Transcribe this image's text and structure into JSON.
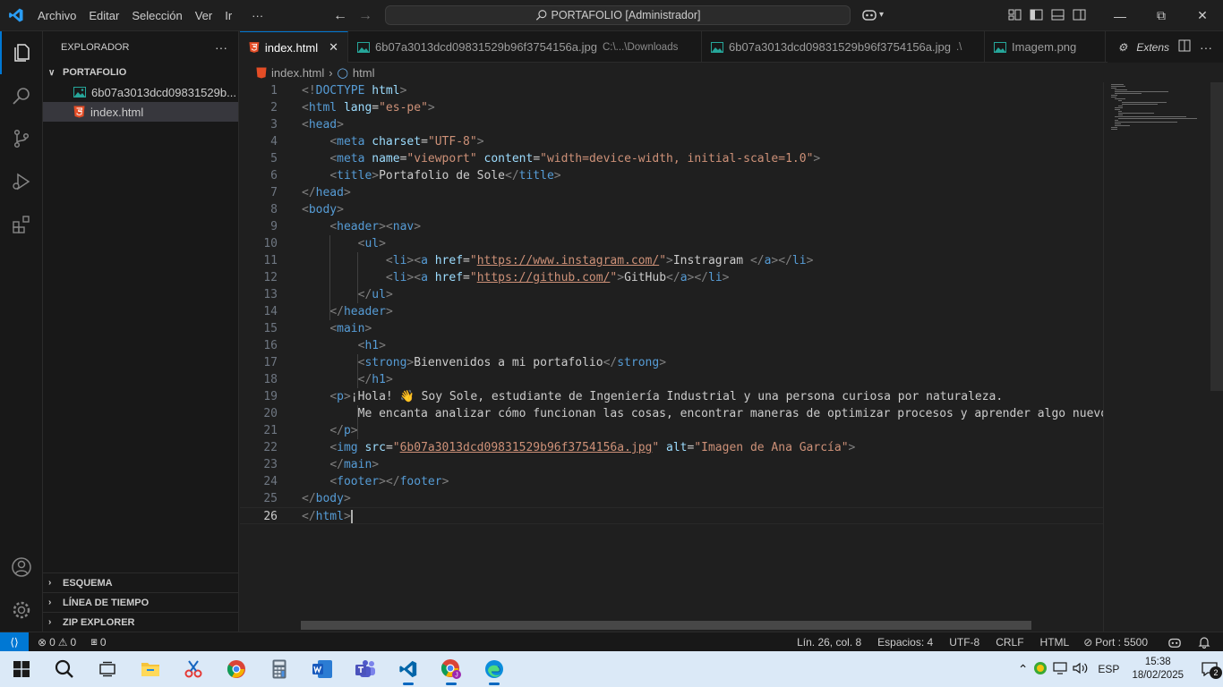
{
  "titlebar": {
    "menu": [
      "Archivo",
      "Editar",
      "Selección",
      "Ver",
      "Ir"
    ],
    "more": "···",
    "command_center": "PORTAFOLIO [Administrador]"
  },
  "sidebar": {
    "title": "EXPLORADOR",
    "more": "···",
    "folder": "PORTAFOLIO",
    "files": [
      {
        "name": "6b07a3013dcd09831529b...",
        "icon": "image-file-icon"
      },
      {
        "name": "index.html",
        "icon": "html-file-icon"
      }
    ],
    "sections": [
      "ESQUEMA",
      "LÍNEA DE TIEMPO",
      "ZIP EXPLORER"
    ]
  },
  "tabs": [
    {
      "label": "index.html",
      "desc": "",
      "active": true
    },
    {
      "label": "6b07a3013dcd09831529b96f3754156a.jpg",
      "desc": "C:\\...\\Downloads",
      "active": false
    },
    {
      "label": "6b07a3013dcd09831529b96f3754156a.jpg",
      "desc": ".\\",
      "active": false
    },
    {
      "label": "Imagem.png",
      "desc": "",
      "active": false
    }
  ],
  "tab_actions": {
    "extens": "Extens"
  },
  "breadcrumb": {
    "file": "index.html",
    "symbol": "html"
  },
  "editor": {
    "current_line": 26,
    "lines": [
      [
        [
          "t",
          "<!"
        ],
        [
          "tag",
          "DOCTYPE"
        ],
        [
          "txt",
          " "
        ],
        [
          "attr",
          "html"
        ],
        [
          "t",
          ">"
        ]
      ],
      [
        [
          "t",
          "<"
        ],
        [
          "tag",
          "html"
        ],
        [
          "txt",
          " "
        ],
        [
          "attr",
          "lang"
        ],
        [
          "txt",
          "="
        ],
        [
          "str",
          "\"es-pe\""
        ],
        [
          "t",
          ">"
        ]
      ],
      [
        [
          "t",
          "<"
        ],
        [
          "tag",
          "head"
        ],
        [
          "t",
          ">"
        ]
      ],
      [
        [
          "txt",
          "    "
        ],
        [
          "t",
          "<"
        ],
        [
          "tag",
          "meta"
        ],
        [
          "txt",
          " "
        ],
        [
          "attr",
          "charset"
        ],
        [
          "txt",
          "="
        ],
        [
          "str",
          "\"UTF-8\""
        ],
        [
          "t",
          ">"
        ]
      ],
      [
        [
          "txt",
          "    "
        ],
        [
          "t",
          "<"
        ],
        [
          "tag",
          "meta"
        ],
        [
          "txt",
          " "
        ],
        [
          "attr",
          "name"
        ],
        [
          "txt",
          "="
        ],
        [
          "str",
          "\"viewport\""
        ],
        [
          "txt",
          " "
        ],
        [
          "attr",
          "content"
        ],
        [
          "txt",
          "="
        ],
        [
          "str",
          "\"width=device-width, initial-scale=1.0\""
        ],
        [
          "t",
          ">"
        ]
      ],
      [
        [
          "txt",
          "    "
        ],
        [
          "t",
          "<"
        ],
        [
          "tag",
          "title"
        ],
        [
          "t",
          ">"
        ],
        [
          "txt",
          "Portafolio de Sole"
        ],
        [
          "t",
          "</"
        ],
        [
          "tag",
          "title"
        ],
        [
          "t",
          ">"
        ]
      ],
      [
        [
          "t",
          "</"
        ],
        [
          "tag",
          "head"
        ],
        [
          "t",
          ">"
        ]
      ],
      [
        [
          "t",
          "<"
        ],
        [
          "tag",
          "body"
        ],
        [
          "t",
          ">"
        ]
      ],
      [
        [
          "txt",
          "    "
        ],
        [
          "t",
          "<"
        ],
        [
          "tag",
          "header"
        ],
        [
          "t",
          "><"
        ],
        [
          "tag",
          "nav"
        ],
        [
          "t",
          ">"
        ]
      ],
      [
        [
          "txt",
          "        "
        ],
        [
          "t",
          "<"
        ],
        [
          "tag",
          "ul"
        ],
        [
          "t",
          ">"
        ]
      ],
      [
        [
          "txt",
          "            "
        ],
        [
          "t",
          "<"
        ],
        [
          "tag",
          "li"
        ],
        [
          "t",
          "><"
        ],
        [
          "tag",
          "a"
        ],
        [
          "txt",
          " "
        ],
        [
          "attr",
          "href"
        ],
        [
          "txt",
          "="
        ],
        [
          "str",
          "\""
        ],
        [
          "link",
          "https://www.instagram.com/"
        ],
        [
          "str",
          "\""
        ],
        [
          "t",
          ">"
        ],
        [
          "txt",
          "Instragram "
        ],
        [
          "t",
          "</"
        ],
        [
          "tag",
          "a"
        ],
        [
          "t",
          "></"
        ],
        [
          "tag",
          "li"
        ],
        [
          "t",
          ">"
        ]
      ],
      [
        [
          "txt",
          "            "
        ],
        [
          "t",
          "<"
        ],
        [
          "tag",
          "li"
        ],
        [
          "t",
          "><"
        ],
        [
          "tag",
          "a"
        ],
        [
          "txt",
          " "
        ],
        [
          "attr",
          "href"
        ],
        [
          "txt",
          "="
        ],
        [
          "str",
          "\""
        ],
        [
          "link",
          "https://github.com/"
        ],
        [
          "str",
          "\""
        ],
        [
          "t",
          ">"
        ],
        [
          "txt",
          "GitHub"
        ],
        [
          "t",
          "</"
        ],
        [
          "tag",
          "a"
        ],
        [
          "t",
          "></"
        ],
        [
          "tag",
          "li"
        ],
        [
          "t",
          ">"
        ]
      ],
      [
        [
          "txt",
          "        "
        ],
        [
          "t",
          "</"
        ],
        [
          "tag",
          "ul"
        ],
        [
          "t",
          ">"
        ]
      ],
      [
        [
          "txt",
          "    "
        ],
        [
          "t",
          "</"
        ],
        [
          "tag",
          "header"
        ],
        [
          "t",
          ">"
        ]
      ],
      [
        [
          "txt",
          "    "
        ],
        [
          "t",
          "<"
        ],
        [
          "tag",
          "main"
        ],
        [
          "t",
          ">"
        ]
      ],
      [
        [
          "txt",
          "        "
        ],
        [
          "t",
          "<"
        ],
        [
          "tag",
          "h1"
        ],
        [
          "t",
          ">"
        ]
      ],
      [
        [
          "txt",
          "        "
        ],
        [
          "t",
          "<"
        ],
        [
          "tag",
          "strong"
        ],
        [
          "t",
          ">"
        ],
        [
          "txt",
          "Bienvenidos a mi portafolio"
        ],
        [
          "t",
          "</"
        ],
        [
          "tag",
          "strong"
        ],
        [
          "t",
          ">"
        ]
      ],
      [
        [
          "txt",
          "        "
        ],
        [
          "t",
          "</"
        ],
        [
          "tag",
          "h1"
        ],
        [
          "t",
          ">"
        ]
      ],
      [
        [
          "txt",
          "    "
        ],
        [
          "t",
          "<"
        ],
        [
          "tag",
          "p"
        ],
        [
          "t",
          ">"
        ],
        [
          "txt",
          "¡Hola! 👋 Soy Sole, estudiante de Ingeniería Industrial y una persona curiosa por naturaleza."
        ]
      ],
      [
        [
          "txt",
          "        Me encanta analizar cómo funcionan las cosas, encontrar maneras de optimizar procesos y aprender algo nuevo c"
        ]
      ],
      [
        [
          "txt",
          "    "
        ],
        [
          "t",
          "</"
        ],
        [
          "tag",
          "p"
        ],
        [
          "t",
          ">"
        ]
      ],
      [
        [
          "txt",
          "    "
        ],
        [
          "t",
          "<"
        ],
        [
          "tag",
          "img"
        ],
        [
          "txt",
          " "
        ],
        [
          "attr",
          "src"
        ],
        [
          "txt",
          "="
        ],
        [
          "str",
          "\""
        ],
        [
          "link",
          "6b07a3013dcd09831529b96f3754156a.jpg"
        ],
        [
          "str",
          "\""
        ],
        [
          "txt",
          " "
        ],
        [
          "attr",
          "alt"
        ],
        [
          "txt",
          "="
        ],
        [
          "str",
          "\"Imagen de Ana García\""
        ],
        [
          "t",
          ">"
        ]
      ],
      [
        [
          "txt",
          "    "
        ],
        [
          "t",
          "</"
        ],
        [
          "tag",
          "main"
        ],
        [
          "t",
          ">"
        ]
      ],
      [
        [
          "txt",
          "    "
        ],
        [
          "t",
          "<"
        ],
        [
          "tag",
          "footer"
        ],
        [
          "t",
          "></"
        ],
        [
          "tag",
          "footer"
        ],
        [
          "t",
          ">"
        ]
      ],
      [
        [
          "t",
          "</"
        ],
        [
          "tag",
          "body"
        ],
        [
          "t",
          ">"
        ]
      ],
      [
        [
          "t",
          "</"
        ],
        [
          "tag",
          "html"
        ],
        [
          "t",
          ">"
        ]
      ]
    ]
  },
  "statusbar": {
    "errors": "0",
    "warnings": "0",
    "ports": "0",
    "position": "Lín. 26, col. 8",
    "spaces": "Espacios: 4",
    "encoding": "UTF-8",
    "eol": "CRLF",
    "language": "HTML",
    "port": "Port : 5500"
  },
  "taskbar": {
    "lang": "ESP",
    "time": "15:38",
    "date": "18/02/2025",
    "notifications": "2"
  },
  "colors": {
    "accent": "#0078d4",
    "html_icon": "#e44d26",
    "image_icon": "#26a69a"
  }
}
